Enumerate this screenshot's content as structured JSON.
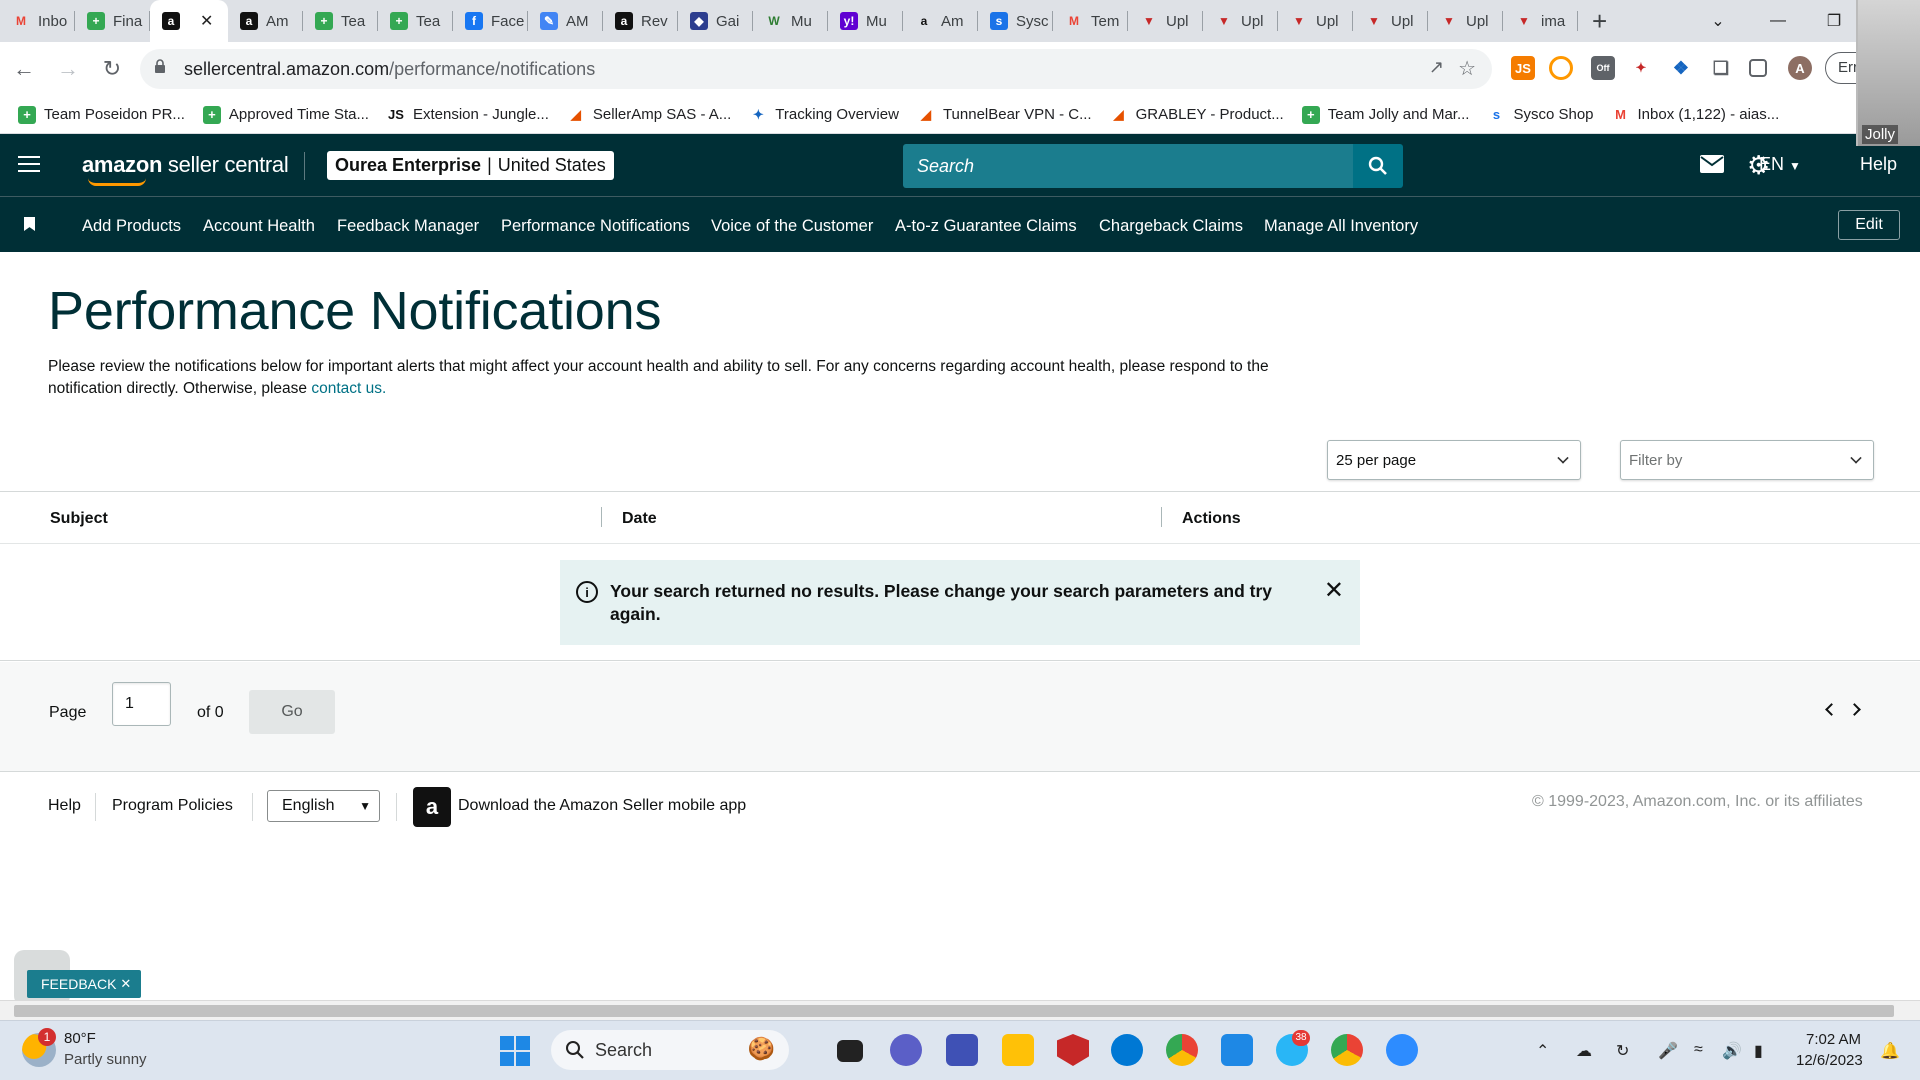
{
  "browser": {
    "tabs": [
      {
        "label": "Inbo",
        "icon": "gmail-icon",
        "color": "#ea4335"
      },
      {
        "label": "Fina",
        "icon": "sheets-plus-icon",
        "color": "#34a853"
      },
      {
        "label": "",
        "icon": "amazon-a-icon",
        "color": "#111111",
        "active": true
      },
      {
        "label": "Am",
        "icon": "amazon-a-icon",
        "color": "#111111"
      },
      {
        "label": "Tea",
        "icon": "sheets-plus-icon",
        "color": "#34a853"
      },
      {
        "label": "Tea",
        "icon": "sheets-plus-icon",
        "color": "#34a853"
      },
      {
        "label": "Face",
        "icon": "facebook-icon",
        "color": "#1877f2"
      },
      {
        "label": "AM",
        "icon": "pencil-icon",
        "color": "#4285f4"
      },
      {
        "label": "Rev",
        "icon": "amazon-a-icon",
        "color": "#111111"
      },
      {
        "label": "Gai",
        "icon": "cube-icon",
        "color": "#2d3e8f"
      },
      {
        "label": "Mu",
        "icon": "w-logo-icon",
        "color": "#2e7d32"
      },
      {
        "label": "Mu",
        "icon": "yahoo-icon",
        "color": "#6001d2"
      },
      {
        "label": "Am",
        "icon": "amazon-smile-icon",
        "color": "#ffffff"
      },
      {
        "label": "Sysc",
        "icon": "sysco-icon",
        "color": "#1a73e8"
      },
      {
        "label": "Tem",
        "icon": "gmail-icon",
        "color": "#ea4335"
      },
      {
        "label": "Upl",
        "icon": "shield-v-icon",
        "color": "#c62828"
      },
      {
        "label": "Upl",
        "icon": "shield-v-icon",
        "color": "#c62828"
      },
      {
        "label": "Upl",
        "icon": "shield-v-icon",
        "color": "#c62828"
      },
      {
        "label": "Upl",
        "icon": "shield-v-icon",
        "color": "#c62828"
      },
      {
        "label": "Upl",
        "icon": "shield-v-icon",
        "color": "#c62828"
      },
      {
        "label": "ima",
        "icon": "shield-v-icon",
        "color": "#c62828"
      }
    ],
    "new_tab": "+",
    "url_domain": "sellercentral.amazon.com",
    "url_path": "/performance/notifications",
    "profile_initial": "A",
    "profile_pill": "Err",
    "ext_badge": "Off",
    "bookmarks": [
      {
        "label": "Team Poseidon PR...",
        "icon": "sheets-plus-icon",
        "color": "#34a853"
      },
      {
        "label": "Approved Time Sta...",
        "icon": "sheets-plus-icon",
        "color": "#34a853"
      },
      {
        "label": "Extension - Jungle...",
        "icon": "js-icon",
        "color": "#111111"
      },
      {
        "label": "SellerAmp SAS - A...",
        "icon": "selleramp-icon",
        "color": "#e65100"
      },
      {
        "label": "Tracking Overview",
        "icon": "tracking-icon",
        "color": "#1565c0"
      },
      {
        "label": "TunnelBear VPN - C...",
        "icon": "tunnelbear-icon",
        "color": "#e65100"
      },
      {
        "label": "GRABLEY - Product...",
        "icon": "grabley-icon",
        "color": "#e65100"
      },
      {
        "label": "Team Jolly and Mar...",
        "icon": "sheets-plus-icon",
        "color": "#34a853"
      },
      {
        "label": "Sysco Shop",
        "icon": "sysco-icon",
        "color": "#1a73e8"
      },
      {
        "label": "Inbox (1,122) - aias...",
        "icon": "gmail-icon",
        "color": "#ea4335"
      }
    ]
  },
  "header": {
    "logo_bold": "amazon",
    "logo_rest": " seller central",
    "store_name": "Ourea Enterprise",
    "store_sep": "|",
    "store_region": "United States",
    "search_placeholder": "Search",
    "language": "EN",
    "help": "Help"
  },
  "nav": {
    "links": [
      "Add Products",
      "Account Health",
      "Feedback Manager",
      "Performance Notifications",
      "Voice of the Customer",
      "A-to-z Guarantee Claims",
      "Chargeback Claims",
      "Manage All Inventory"
    ],
    "edit": "Edit"
  },
  "main": {
    "title": "Performance Notifications",
    "intro": "Please review the notifications below for important alerts that might affect your account health and ability to sell. For any concerns regarding account health, please respond to the notification directly. Otherwise, please ",
    "intro_link": "contact us.",
    "per_page": "25 per page",
    "filter_placeholder": "Filter by",
    "columns": [
      "Subject",
      "Date",
      "Actions"
    ],
    "alert": "Your search returned no results. Please change your search parameters and try again.",
    "page_label": "Page",
    "page_value": "1",
    "of_label": "of 0",
    "go": "Go"
  },
  "footer": {
    "help": "Help",
    "policies": "Program Policies",
    "language": "English",
    "app_text": "Download the Amazon Seller mobile app",
    "copyright": "© 1999-2023, Amazon.com, Inc. or its affiliates"
  },
  "feedback": "FEEDBACK",
  "camera_label": "Jolly",
  "taskbar": {
    "temp": "80°F",
    "weather": "Partly sunny",
    "weather_badge": "1",
    "search": "Search",
    "time": "7:02 AM",
    "date": "12/6/2023",
    "telegram_badge": "38"
  },
  "colors": {
    "header_bg": "#002f36",
    "search_bg": "#1b7d8e",
    "link": "#007185",
    "alert_bg": "#e6f2f2"
  }
}
